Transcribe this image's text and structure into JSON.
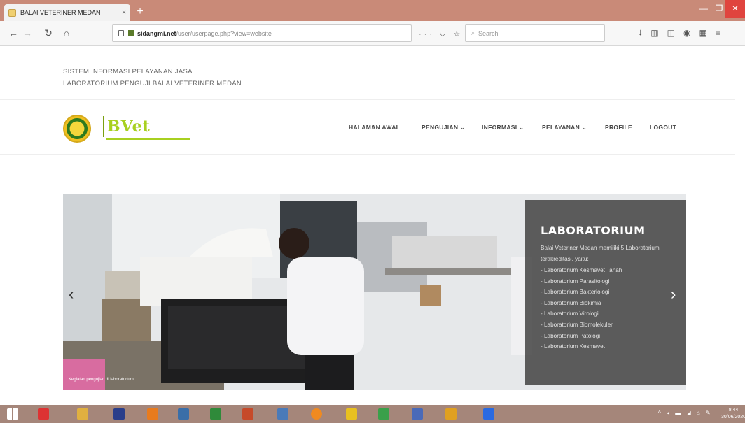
{
  "browser": {
    "tab_title": "BALAI VETERINER MEDAN",
    "tab_close": "×",
    "new_tab": "+",
    "url_domain": "sidangmi.net",
    "url_path": "/user/userpage.php?view=website",
    "url_actions": "··· ⛉ ☆",
    "search_placeholder": "Search"
  },
  "site": {
    "header_line1": "SISTEM INFORMASI PELAYANAN JASA",
    "header_line2": "LABORATORIUM PENGUJI BALAI VETERINER MEDAN",
    "logo_text": "BVet"
  },
  "nav": {
    "items": [
      {
        "label": "HALAMAN AWAL"
      },
      {
        "label": "PENGUJIAN ⌄"
      },
      {
        "label": "INFORMASI ⌄"
      },
      {
        "label": "PELAYANAN ⌄"
      },
      {
        "label": "PROFILE"
      },
      {
        "label": "LOGOUT"
      }
    ]
  },
  "slider": {
    "prev": "‹",
    "next": "›",
    "caption_title": "LABORATORIUM",
    "caption_intro": "Balai Veteriner Medan memiliki 5 Laboratorium terakreditasi, yaitu:",
    "labs": [
      "- Laboratorium Kesmavet Tanah",
      "- Laboratorium Parasitologi",
      "- Laboratorium Bakteriologi",
      "- Laboratorium Biokimia",
      "- Laboratorium Virologi",
      "- Laboratorium Biomolekuler",
      "- Laboratorium Patologi",
      "- Laboratorium Kesmavet"
    ],
    "photo_credit": "Kegiatan pengujian di laboratorium"
  },
  "taskbar": {
    "tray": "^ ◂ ▬ ◢ ⌂ ✎",
    "time": "8:44",
    "date": "30/06/2020"
  },
  "colors": {
    "titlebar": "#c98a78",
    "taskbar": "#a5867a",
    "caption_bg": "#3c3c3c",
    "logo_green": "#a8d020"
  }
}
